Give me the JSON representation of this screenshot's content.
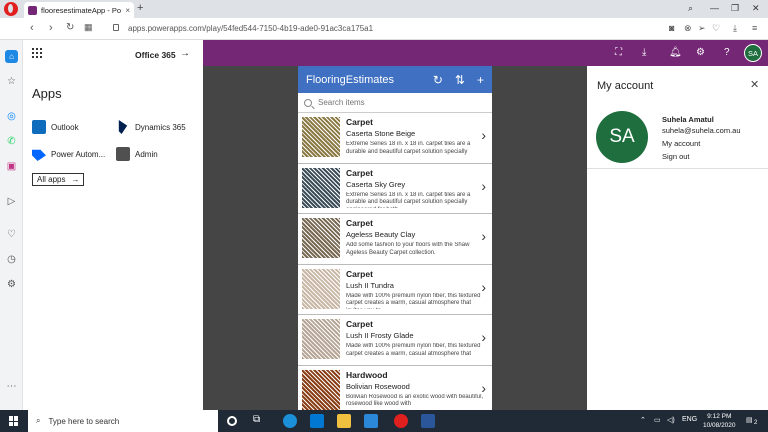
{
  "browser": {
    "tab_title": "flooresestimateApp - Power",
    "tab_close": "×",
    "new_tab": "+",
    "url": "apps.powerapps.com/play/54fed544-7150-4b19-ade0-91ac3ca175a1"
  },
  "apps_panel": {
    "office_label": "Office 365",
    "heading": "Apps",
    "apps": [
      {
        "label": "Outlook",
        "color": "#0f6cbd"
      },
      {
        "label": "Dynamics 365",
        "color": "#002050"
      },
      {
        "label": "Power Autom...",
        "color": "#0066ff"
      },
      {
        "label": "Admin",
        "color": "#505050"
      }
    ],
    "all_apps": "All apps"
  },
  "app": {
    "title": "FlooringEstimates",
    "search_placeholder": "Search items",
    "items": [
      {
        "category": "Carpet",
        "name": "Caserta Stone Beige",
        "description": "Extreme Series 18 in. x 18 in. carpet tiles are a durable and beautiful carpet solution specially engineered for both",
        "color": "#8c7a45"
      },
      {
        "category": "Carpet",
        "name": "Caserta Sky Grey",
        "description": "Extreme Series 18 in. x 18 in. carpet tiles are a durable and beautiful carpet solution specially engineered for both",
        "color": "#3d4e5a"
      },
      {
        "category": "Carpet",
        "name": "Ageless Beauty Clay",
        "description": "Add some fashion to your floors with the Shaw Ageless Beauty Carpet collection.",
        "color": "#7a6a55"
      },
      {
        "category": "Carpet",
        "name": "Lush II Tundra",
        "description": "Made with 100% premium nylon fiber, this textured carpet creates a warm, casual atmosphere that invites you to",
        "color": "#c9b8a6"
      },
      {
        "category": "Carpet",
        "name": "Lush II Frosty Glade",
        "description": "Made with 100% premium nylon fiber, this textured carpet creates a warm, casual atmosphere that invites you to",
        "color": "#b7a696"
      },
      {
        "category": "Hardwood",
        "name": "Bolivian Rosewood",
        "description": "Bolivian Rosewood is an exotic wood with beautiful, rosewood like wood with",
        "color": "#8a3f17"
      }
    ]
  },
  "account": {
    "title": "My account",
    "initials": "SA",
    "name": "Suhela Amatul",
    "email": "suhela@suhela.com.au",
    "my_account": "My account",
    "sign_out": "Sign out"
  },
  "taskbar": {
    "search_placeholder": "Type here to search",
    "language": "ENG",
    "time": "9:12 PM",
    "date": "10/08/2020",
    "notification_count": "2"
  }
}
